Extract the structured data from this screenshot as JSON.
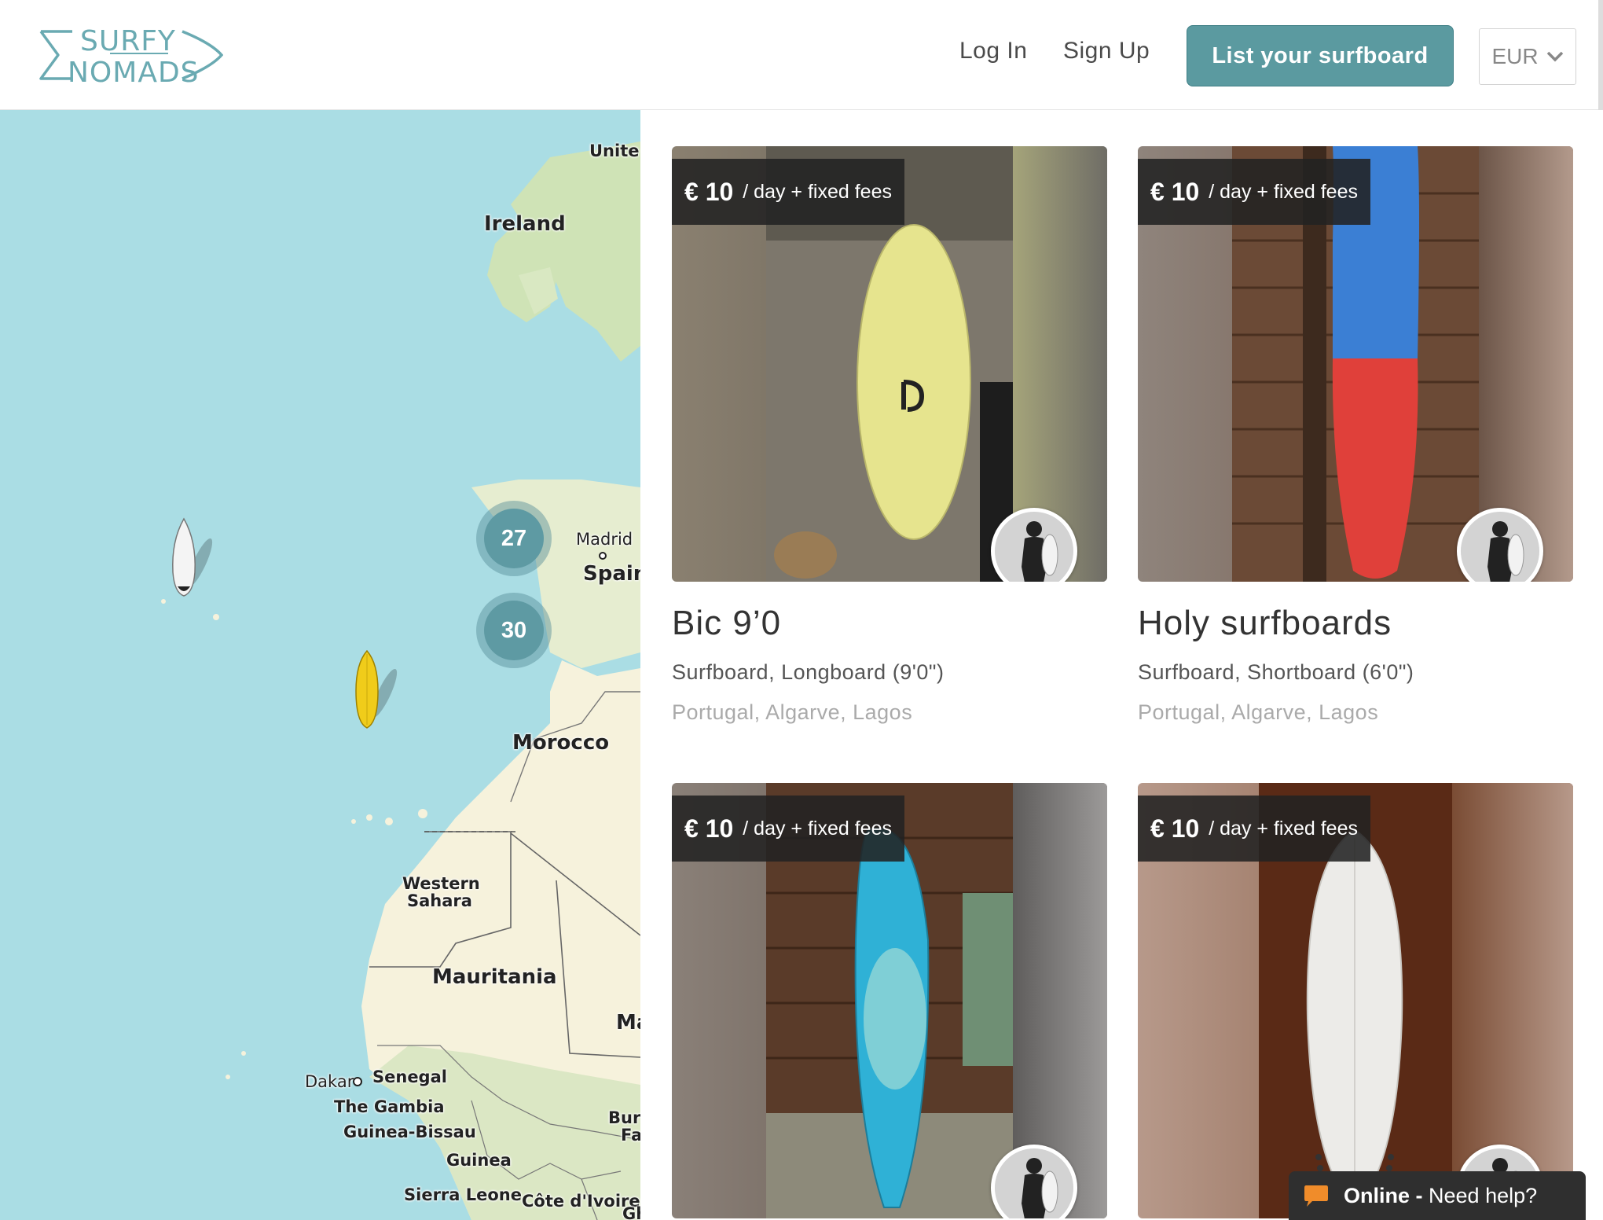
{
  "header": {
    "logo_line1": "SURFY",
    "logo_line2": "NOMADS",
    "login": "Log In",
    "signup": "Sign Up",
    "list_button": "List your surfboard",
    "currency": "EUR",
    "brand_color": "#5b9aa0"
  },
  "map": {
    "labels": {
      "ireland": "Ireland",
      "uk": "Unite Kingdo",
      "madrid": "Madrid",
      "spain": "Spain",
      "morocco": "Morocco",
      "western_sahara_1": "Western",
      "western_sahara_2": "Sahara",
      "mauritania": "Mauritania",
      "mali": "Ma",
      "dakar": "Dakar",
      "senegal": "Senegal",
      "gambia": "The Gambia",
      "guinea_bissau": "Guinea-Bissau",
      "guinea": "Guinea",
      "sierra_leone": "Sierra Leone",
      "cote_divoire": "Côte d'Ivoire",
      "burkina_1": "Burk",
      "burkina_2": "Fa",
      "ghana": "Gh"
    },
    "clusters": [
      "27",
      "30"
    ],
    "markers": [
      "white-surfboard-icon",
      "yellow-surfboard-icon"
    ]
  },
  "listings": [
    {
      "price": "€ 10",
      "price_suffix": "/ day + fixed fees",
      "title": "Bic 9’0",
      "type": "Surfboard, Longboard (9'0\")",
      "location": "Portugal, Algarve, Lagos"
    },
    {
      "price": "€ 10",
      "price_suffix": "/ day + fixed fees",
      "title": "Holy surfboards",
      "type": "Surfboard, Shortboard (6'0\")",
      "location": "Portugal, Algarve, Lagos"
    },
    {
      "price": "€ 10",
      "price_suffix": "/ day + fixed fees",
      "title": "",
      "type": "",
      "location": ""
    },
    {
      "price": "€ 10",
      "price_suffix": "/ day + fixed fees",
      "title": "",
      "type": "",
      "location": ""
    }
  ],
  "chat": {
    "online": "Online -",
    "help": "Need help?"
  }
}
